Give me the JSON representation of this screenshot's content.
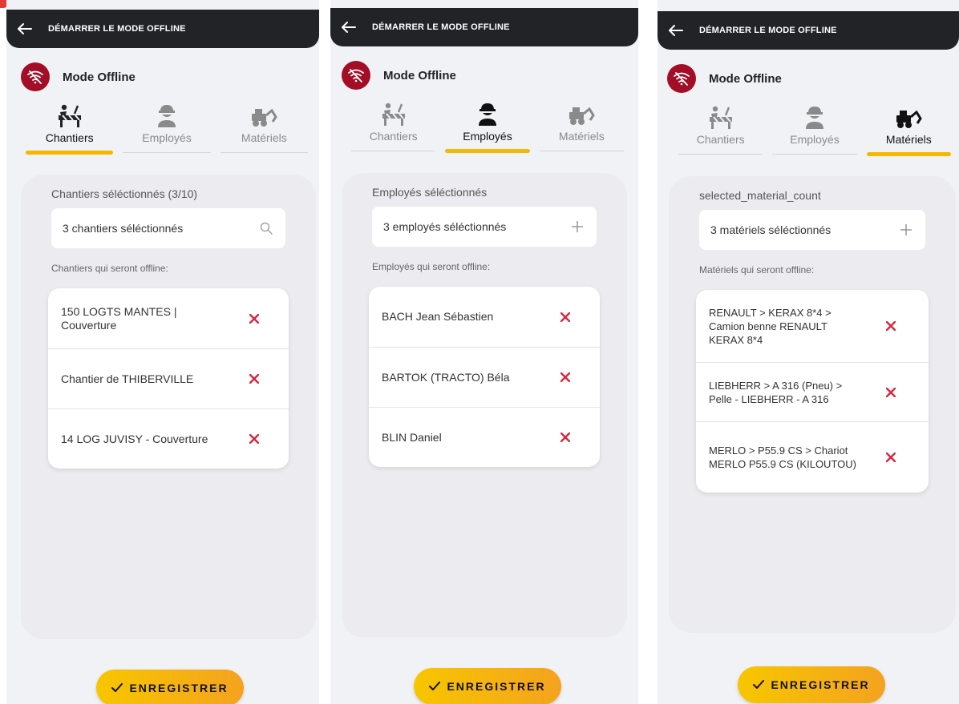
{
  "colors": {
    "topbar": "#222326",
    "accent": "#f5b800",
    "offline_badge": "#a30d26",
    "remove": "#d7263d"
  },
  "screens": [
    {
      "topbar_title": "DÉMARRER LE MODE OFFLINE",
      "mode_label": "Mode Offline",
      "tabs": [
        {
          "label": "Chantiers",
          "icon": "construction-barrier-icon",
          "active": true
        },
        {
          "label": "Employés",
          "icon": "worker-icon",
          "active": false
        },
        {
          "label": "Matériels",
          "icon": "excavator-icon",
          "active": false
        }
      ],
      "selection_title": "Chantiers séléctionnés (3/10)",
      "input_value": "3 chantiers séléctionnés",
      "input_icon": "search-icon",
      "offline_label": "Chantiers qui seront offline:",
      "items": [
        "150 LOGTS MANTES | Couverture",
        "Chantier de THIBERVILLE",
        "14 LOG JUVISY - Couverture"
      ],
      "save_label": "ENREGISTRER"
    },
    {
      "topbar_title": "DÉMARRER LE MODE OFFLINE",
      "mode_label": "Mode Offline",
      "tabs": [
        {
          "label": "Chantiers",
          "icon": "construction-barrier-icon",
          "active": false
        },
        {
          "label": "Employés",
          "icon": "worker-icon",
          "active": true
        },
        {
          "label": "Matériels",
          "icon": "excavator-icon",
          "active": false
        }
      ],
      "selection_title": "Employés séléctionnés",
      "input_value": "3 employés séléctionnés",
      "input_icon": "plus-icon",
      "offline_label": "Employés qui seront offline:",
      "items": [
        "BACH Jean Sébastien",
        "BARTOK (TRACTO) Béla",
        "BLIN Daniel"
      ],
      "save_label": "ENREGISTRER"
    },
    {
      "topbar_title": "DÉMARRER LE MODE OFFLINE",
      "mode_label": "Mode Offline",
      "tabs": [
        {
          "label": "Chantiers",
          "icon": "construction-barrier-icon",
          "active": false
        },
        {
          "label": "Employés",
          "icon": "worker-icon",
          "active": false
        },
        {
          "label": "Matériels",
          "icon": "excavator-icon",
          "active": true
        }
      ],
      "selection_title": "selected_material_count",
      "input_value": "3 matériels séléctionnés",
      "input_icon": "plus-icon",
      "offline_label": "Matériels qui seront offline:",
      "items": [
        "RENAULT > KERAX 8*4 > Camion benne RENAULT KERAX 8*4",
        "LIEBHERR > A 316 (Pneu) > Pelle - LIEBHERR - A 316",
        "MERLO > P55.9 CS > Chariot MERLO P55.9 CS (KILOUTOU)"
      ],
      "save_label": "ENREGISTRER"
    }
  ]
}
